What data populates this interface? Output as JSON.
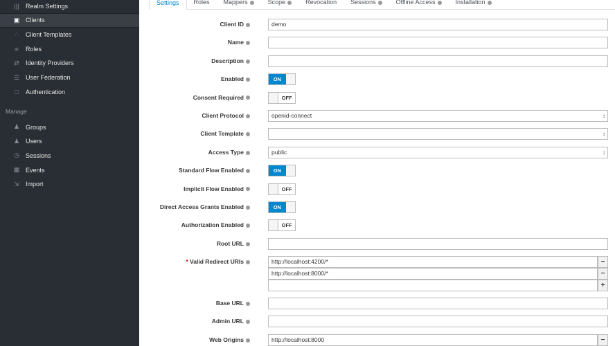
{
  "sidebar": {
    "items": [
      {
        "label": "Realm Settings",
        "icon": "sliders-icon",
        "glyph": "|||",
        "active": false
      },
      {
        "label": "Clients",
        "icon": "cube-icon",
        "glyph": "▣",
        "active": true
      },
      {
        "label": "Client Templates",
        "icon": "cubes-icon",
        "glyph": "∴",
        "active": false
      },
      {
        "label": "Roles",
        "icon": "roles-icon",
        "glyph": "≡",
        "active": false
      },
      {
        "label": "Identity Providers",
        "icon": "exchange-icon",
        "glyph": "⇄",
        "active": false
      },
      {
        "label": "User Federation",
        "icon": "database-icon",
        "glyph": "☰",
        "active": false
      },
      {
        "label": "Authentication",
        "icon": "lock-icon",
        "glyph": "□",
        "active": false
      }
    ],
    "manage_label": "Manage",
    "manage_items": [
      {
        "label": "Groups",
        "icon": "groups-icon",
        "glyph": "♟"
      },
      {
        "label": "Users",
        "icon": "user-icon",
        "glyph": "♟"
      },
      {
        "label": "Sessions",
        "icon": "clock-icon",
        "glyph": "◷"
      },
      {
        "label": "Events",
        "icon": "calendar-icon",
        "glyph": "▦"
      },
      {
        "label": "Import",
        "icon": "import-icon",
        "glyph": "⇲"
      }
    ]
  },
  "tabs": [
    {
      "label": "Settings",
      "help": false,
      "active": true
    },
    {
      "label": "Roles",
      "help": false
    },
    {
      "label": "Mappers",
      "help": true
    },
    {
      "label": "Scope",
      "help": true
    },
    {
      "label": "Revocation",
      "help": false
    },
    {
      "label": "Sessions",
      "help": true
    },
    {
      "label": "Offline Access",
      "help": true
    },
    {
      "label": "Installation",
      "help": true
    }
  ],
  "form": [
    {
      "label": "Client ID",
      "type": "text",
      "value": "demo"
    },
    {
      "label": "Name",
      "type": "text",
      "value": ""
    },
    {
      "label": "Description",
      "type": "text",
      "value": ""
    },
    {
      "label": "Enabled",
      "type": "toggle",
      "value": "ON"
    },
    {
      "label": "Consent Required",
      "type": "toggle",
      "value": "OFF"
    },
    {
      "label": "Client Protocol",
      "type": "select",
      "value": "openid-connect"
    },
    {
      "label": "Client Template",
      "type": "select",
      "value": ""
    },
    {
      "label": "Access Type",
      "type": "select",
      "value": "public"
    },
    {
      "label": "Standard Flow Enabled",
      "type": "toggle",
      "value": "ON"
    },
    {
      "label": "Implicit Flow Enabled",
      "type": "toggle",
      "value": "OFF"
    },
    {
      "label": "Direct Access Grants Enabled",
      "type": "toggle",
      "value": "ON"
    },
    {
      "label": "Authorization Enabled",
      "type": "toggle",
      "value": "OFF"
    },
    {
      "label": "Root URL",
      "type": "text",
      "value": ""
    },
    {
      "label": "Valid Redirect URIs",
      "required": true,
      "type": "multi",
      "values": [
        "http://localhost:4200/*",
        "http://localhost:8000/*",
        ""
      ]
    },
    {
      "label": "Base URL",
      "type": "text",
      "value": ""
    },
    {
      "label": "Admin URL",
      "type": "text",
      "value": ""
    },
    {
      "label": "Web Origins",
      "type": "multi",
      "values": [
        "http://localhost:8000"
      ]
    }
  ]
}
